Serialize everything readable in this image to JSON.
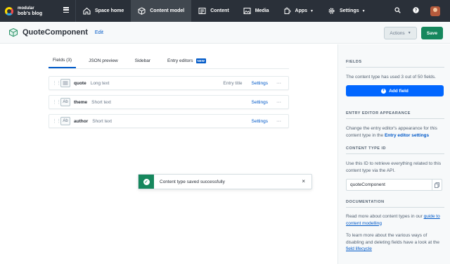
{
  "topnav": {
    "org_name": "modular",
    "space_name": "bob's blog",
    "items": [
      {
        "label": "Space home",
        "icon": "home-icon"
      },
      {
        "label": "Content model",
        "icon": "cube-icon"
      },
      {
        "label": "Content",
        "icon": "content-icon"
      },
      {
        "label": "Media",
        "icon": "media-icon"
      },
      {
        "label": "Apps",
        "icon": "puzzle-icon"
      },
      {
        "label": "Settings",
        "icon": "gear-icon"
      }
    ],
    "right_icons": [
      "search-icon",
      "help-icon"
    ]
  },
  "header": {
    "title": "QuoteComponent",
    "edit_label": "Edit",
    "actions_label": "Actions",
    "save_label": "Save"
  },
  "tabs": [
    {
      "label": "Fields (3)"
    },
    {
      "label": "JSON preview"
    },
    {
      "label": "Sidebar"
    },
    {
      "label": "Entry editors",
      "badge": "NEW"
    }
  ],
  "fields": [
    {
      "name": "quote",
      "type": "Long text",
      "icon_text": "",
      "entry_title": "Entry title",
      "settings": "Settings",
      "more": "···"
    },
    {
      "name": "theme",
      "type": "Short text",
      "icon_text": "Ab",
      "entry_title": "",
      "settings": "Settings",
      "more": "···"
    },
    {
      "name": "author",
      "type": "Short text",
      "icon_text": "Ab",
      "entry_title": "",
      "settings": "Settings",
      "more": "···"
    }
  ],
  "toast": {
    "message": "Content type saved successfully",
    "close": "×"
  },
  "sidebar": {
    "fields_heading": "FIELDS",
    "fields_text": "The content type has used 3 out of 50 fields.",
    "add_field_label": "Add field",
    "editor_heading": "ENTRY EDITOR APPEARANCE",
    "editor_text": "Change the entry editor's appearance for this content type in the",
    "editor_link": "Entry editor settings",
    "id_heading": "CONTENT TYPE ID",
    "id_text": "Use this ID to retrieve everything related to this content type via the API.",
    "id_value": "quoteComponent",
    "docs_heading": "DOCUMENTATION",
    "docs_text1": "Read more about content types in our",
    "docs_link1": "guide to content modelling",
    "docs_text2": "To learn more about the various ways of disabling and deleting fields have a look at the",
    "docs_link2": "field lifecycle"
  }
}
